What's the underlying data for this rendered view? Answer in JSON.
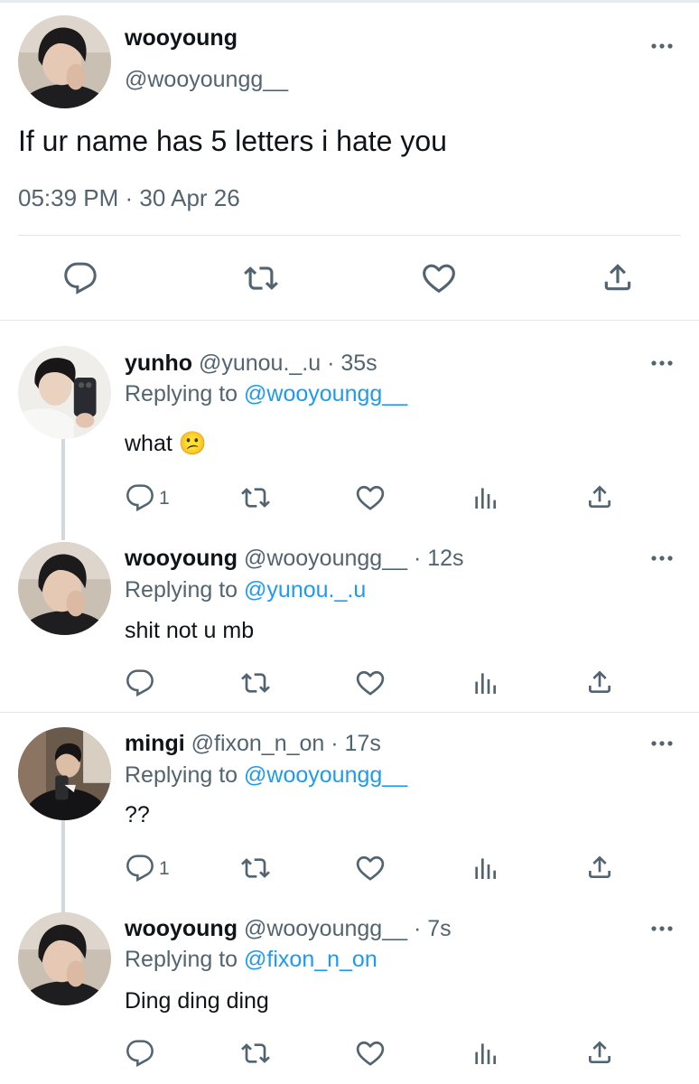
{
  "main_tweet": {
    "name": "wooyoung",
    "handle": "@wooyoungg__",
    "text": "If ur name has 5 letters i hate you",
    "timestamp": "05:39 PM · 30 Apr 26"
  },
  "replies": [
    {
      "name": "yunho",
      "handle_time": "@yunou._.u · 35s",
      "replying_label": "Replying to",
      "replying_to": "@wooyoungg__",
      "text": "what",
      "emoji": "😕",
      "reply_count": "1"
    },
    {
      "name": "wooyoung",
      "handle_time": "@wooyoungg__ · 12s",
      "replying_label": "Replying to",
      "replying_to": "@yunou._.u",
      "text": "shit not u mb",
      "reply_count": ""
    },
    {
      "name": "mingi",
      "handle_time": "@fixon_n_on · 17s",
      "replying_label": "Replying to",
      "replying_to": "@wooyoungg__",
      "text": "??",
      "reply_count": "1"
    },
    {
      "name": "wooyoung",
      "handle_time": "@wooyoungg__ · 7s",
      "replying_label": "Replying to",
      "replying_to": "@fixon_n_on",
      "text": "Ding ding ding",
      "reply_count": ""
    }
  ],
  "colors": {
    "link": "#1d9bf0",
    "muted": "#536471",
    "text": "#0f1419",
    "divider": "#e1e5e8"
  },
  "icons": [
    "reply-icon",
    "retweet-icon",
    "like-icon",
    "share-icon",
    "views-icon",
    "more-icon"
  ]
}
